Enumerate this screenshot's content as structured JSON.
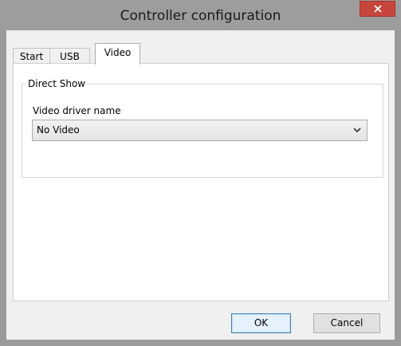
{
  "window": {
    "title": "Controller configuration",
    "close_icon": "close-icon"
  },
  "tabs": [
    {
      "label": "Start",
      "selected": false
    },
    {
      "label": "USB",
      "selected": false
    },
    {
      "label": "Video",
      "selected": true
    }
  ],
  "video_tab": {
    "group_title": "Direct Show",
    "driver_label": "Video driver name",
    "driver_select": {
      "value": "No Video",
      "arrow_icon": "chevron-down-icon"
    }
  },
  "buttons": {
    "ok_label": "OK",
    "cancel_label": "Cancel"
  },
  "colors": {
    "close_button": "#c7463b",
    "frame": "#9d9d9d",
    "default_button_border": "#3c7fb1"
  }
}
